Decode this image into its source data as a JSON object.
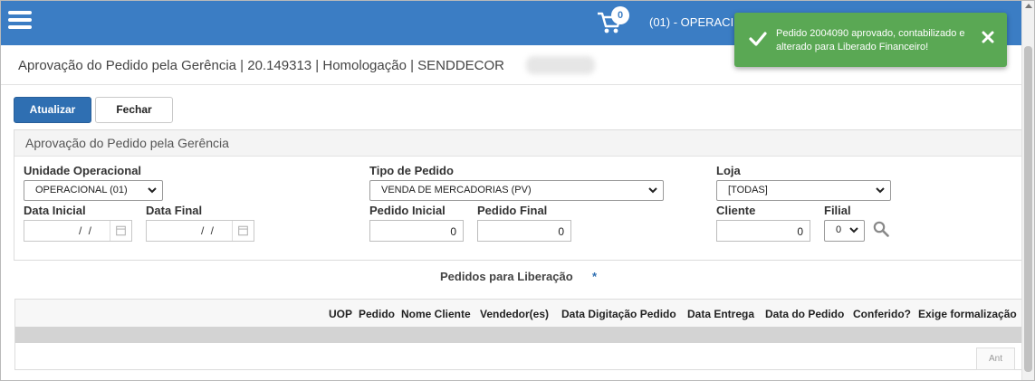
{
  "colors": {
    "accent": "#3b7dc4",
    "primary_button": "#2f6fb2",
    "success_toast": "#5aa854"
  },
  "header": {
    "menu_icon": "hamburger-menu-icon",
    "cart_icon": "shopping-cart-icon",
    "cart_count": "0",
    "unit_label": "(01) - OPERACI"
  },
  "page": {
    "title": "Aprovação do Pedido pela Gerência | 20.149313 | Homologação | SENDDECOR"
  },
  "toolbar": {
    "refresh_label": "Atualizar",
    "close_label": "Fechar"
  },
  "panel": {
    "title": "Aprovação do Pedido pela Gerência",
    "fields": {
      "unidade": {
        "label": "Unidade Operacional",
        "value": "OPERACIONAL (01)"
      },
      "tipo": {
        "label": "Tipo de Pedido",
        "value": "VENDA DE MERCADORIAS (PV)"
      },
      "loja": {
        "label": "Loja",
        "value": "[TODAS]"
      },
      "data_inicial": {
        "label": "Data Inicial",
        "value": "/ /"
      },
      "data_final": {
        "label": "Data Final",
        "value": "/ /"
      },
      "pedido_inicial": {
        "label": "Pedido Inicial",
        "value": "0"
      },
      "pedido_final": {
        "label": "Pedido Final",
        "value": "0"
      },
      "cliente": {
        "label": "Cliente",
        "value": "0"
      },
      "filial": {
        "label": "Filial",
        "value": "0"
      }
    }
  },
  "pedidos": {
    "title": "Pedidos para Liberação",
    "required_mark": "*",
    "columns": [
      "UOP",
      "Pedido",
      "Nome Cliente",
      "Vendedor(es)",
      "Data Digitação Pedido",
      "Data Entrega",
      "Data do Pedido",
      "Conferido?",
      "Exige formalização"
    ],
    "pager_prev": "Ant"
  },
  "toast": {
    "message": "Pedido 2004090 aprovado, contabilizado e alterado para Liberado Financeiro!",
    "icon": "check-icon",
    "close_icon": "close-icon"
  }
}
